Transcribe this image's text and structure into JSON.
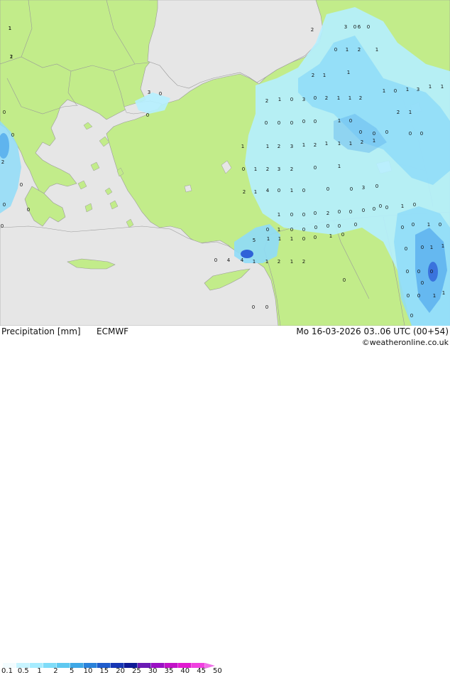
{
  "map": {
    "colors": {
      "sea": "#e6e6e6",
      "land": "#c2ec8a",
      "border": "#9a9a9a",
      "precip_light": "#b5f0ff",
      "precip_mid": "#8fdcf8",
      "precip_strong": "#5fb4ee",
      "precip_heavy": "#2f62d8"
    },
    "precip_labels": [
      "1",
      "2",
      "0",
      "0",
      "2",
      "0",
      "0",
      "0",
      "0",
      "2",
      "3",
      "0",
      "6",
      "0",
      "0",
      "1",
      "2",
      "1",
      "2",
      "1",
      "1",
      "3",
      "0",
      "0",
      "2",
      "1",
      "0",
      "3",
      "0",
      "2",
      "1",
      "1",
      "2",
      "1",
      "0",
      "1",
      "3",
      "1",
      "1",
      "2",
      "1",
      "0",
      "0",
      "0",
      "0",
      "0",
      "1",
      "0",
      "0",
      "0",
      "0",
      "0",
      "0",
      "1",
      "1",
      "2",
      "3",
      "1",
      "2",
      "1",
      "1",
      "1",
      "2",
      "1",
      "0",
      "1",
      "2",
      "3",
      "2",
      "0",
      "1",
      "2",
      "1",
      "4",
      "0",
      "1",
      "0",
      "0",
      "0",
      "3",
      "0",
      "1",
      "0",
      "0",
      "0",
      "2",
      "0",
      "0",
      "0",
      "0",
      "0",
      "1",
      "0",
      "0",
      "1",
      "0",
      "0",
      "0",
      "0",
      "0",
      "0",
      "0",
      "0",
      "1",
      "0",
      "5",
      "1",
      "1",
      "1",
      "0",
      "0",
      "1",
      "0",
      "0",
      "4",
      "4",
      "1",
      "1",
      "2",
      "1",
      "2",
      "0",
      "0",
      "1",
      "1",
      "0",
      "0",
      "0",
      "0",
      "0",
      "1",
      "1",
      "0",
      "0",
      "0",
      "0",
      "0",
      "0",
      "1",
      "1"
    ]
  },
  "footer": {
    "title": "Precipitation [mm]",
    "model": "ECMWF",
    "valid_time": "Mo 16-03-2026 03..06 UTC (00+54)",
    "copyright": "©weatheronline.co.uk"
  },
  "legend": {
    "colors": [
      "#f2fcff",
      "#c8f4ff",
      "#a6ecff",
      "#7fdcf8",
      "#5ec8f0",
      "#3fa8e6",
      "#2a82da",
      "#1f5ccc",
      "#1636b4",
      "#0f1a96",
      "#6a1ab4",
      "#9a10c4",
      "#c212c8",
      "#e01ad0",
      "#f040e0"
    ],
    "arrow_color": "#f070e8",
    "ticks": [
      "0.1",
      "0.5",
      "1",
      "2",
      "5",
      "10",
      "15",
      "20",
      "25",
      "30",
      "35",
      "40",
      "45",
      "50"
    ]
  }
}
